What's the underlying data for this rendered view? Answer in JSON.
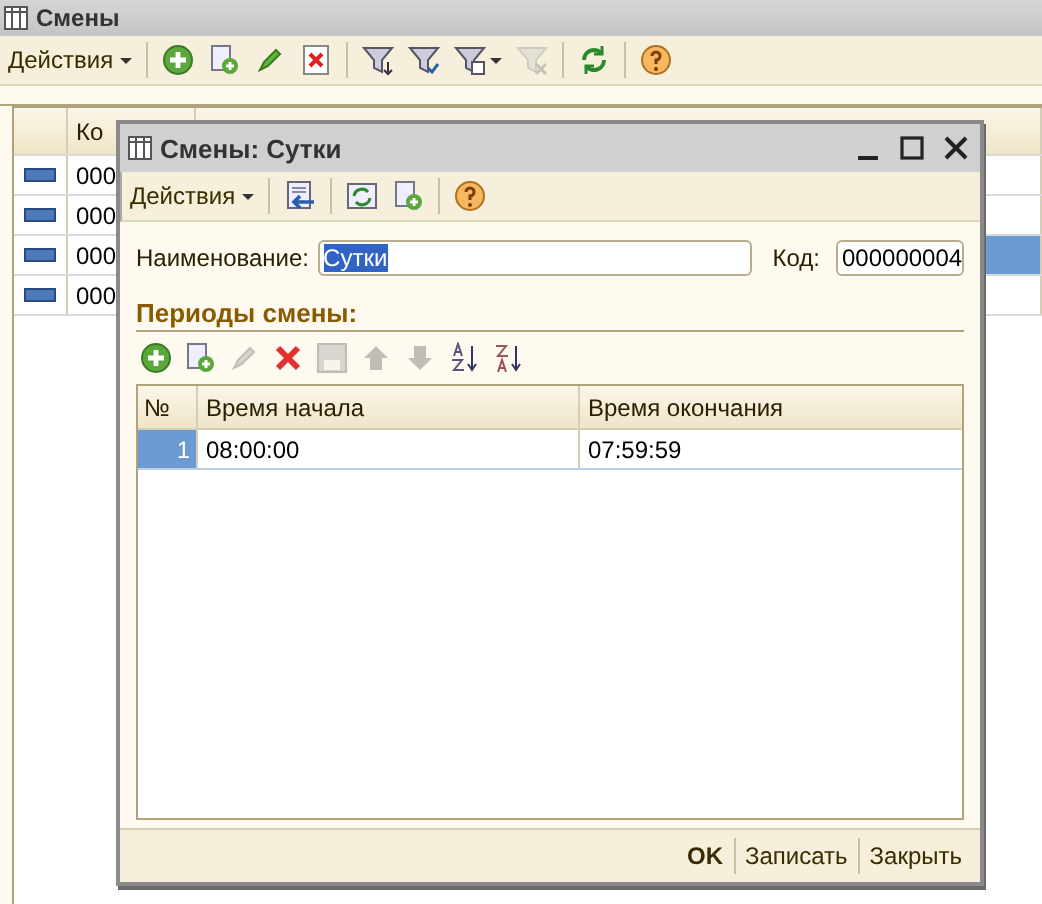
{
  "main_window": {
    "title": "Смены",
    "toolbar": {
      "actions": "Действия",
      "tools": [
        {
          "kind": "add",
          "disabled": false
        },
        {
          "kind": "copy",
          "disabled": false
        },
        {
          "kind": "edit",
          "disabled": false
        },
        {
          "kind": "delete",
          "disabled": false
        },
        {
          "kind": "separator"
        },
        {
          "kind": "filter-set",
          "disabled": false
        },
        {
          "kind": "filter-check",
          "disabled": false
        },
        {
          "kind": "filter-list",
          "disabled": false
        },
        {
          "kind": "filter-clear",
          "disabled": true
        },
        {
          "kind": "separator"
        },
        {
          "kind": "refresh",
          "disabled": false
        },
        {
          "kind": "separator"
        },
        {
          "kind": "help",
          "disabled": false
        }
      ]
    },
    "table": {
      "columns": [
        "Ко"
      ],
      "rows": [
        {
          "code": "000",
          "selected": false
        },
        {
          "code": "000",
          "selected": false
        },
        {
          "code": "000",
          "selected": true
        },
        {
          "code": "000",
          "selected": false
        }
      ]
    }
  },
  "dialog": {
    "title": "Смены: Сутки",
    "toolbar": {
      "actions": "Действия",
      "tools": [
        {
          "kind": "save-close",
          "disabled": false
        },
        {
          "kind": "separator"
        },
        {
          "kind": "reread",
          "disabled": false
        },
        {
          "kind": "copy",
          "disabled": false
        },
        {
          "kind": "separator"
        },
        {
          "kind": "help",
          "disabled": false
        }
      ]
    },
    "name_label": "Наименование:",
    "name_value": "Сутки",
    "code_label": "Код:",
    "code_value": "000000004",
    "section_title": "Периоды смены:",
    "periods_toolbar": [
      {
        "kind": "add",
        "disabled": false
      },
      {
        "kind": "copy",
        "disabled": false
      },
      {
        "kind": "edit",
        "disabled": true
      },
      {
        "kind": "delete",
        "disabled": false
      },
      {
        "kind": "save",
        "disabled": true
      },
      {
        "kind": "up",
        "disabled": true
      },
      {
        "kind": "down",
        "disabled": true
      },
      {
        "kind": "sort-asc",
        "disabled": false
      },
      {
        "kind": "sort-desc",
        "disabled": false
      }
    ],
    "periods": {
      "columns": [
        "№",
        "Время начала",
        "Время окончания"
      ],
      "rows": [
        {
          "number": "1",
          "start": "08:00:00",
          "end": "07:59:59",
          "selected": true
        }
      ]
    },
    "buttons": [
      {
        "label": "OK",
        "default": true
      },
      {
        "label": "Записать",
        "default": false
      },
      {
        "label": "Закрыть",
        "default": false
      }
    ]
  }
}
